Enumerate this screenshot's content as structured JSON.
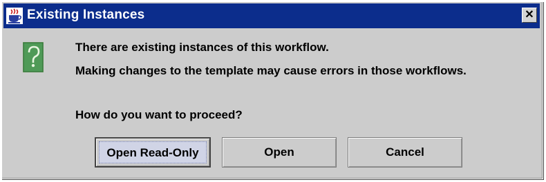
{
  "window": {
    "title": "Existing Instances",
    "close_glyph": "✕",
    "title_icon": "java-cup-icon",
    "titlebar_color": "#0c2d8c"
  },
  "message": {
    "icon": "question-icon",
    "line1": "There are existing instances of this workflow.",
    "line2": "Making changes to the template may cause errors in those workflows.",
    "line3": "How do you want to proceed?"
  },
  "buttons": {
    "read_only_label": "Open Read-Only",
    "open_label": "Open",
    "cancel_label": "Cancel"
  }
}
